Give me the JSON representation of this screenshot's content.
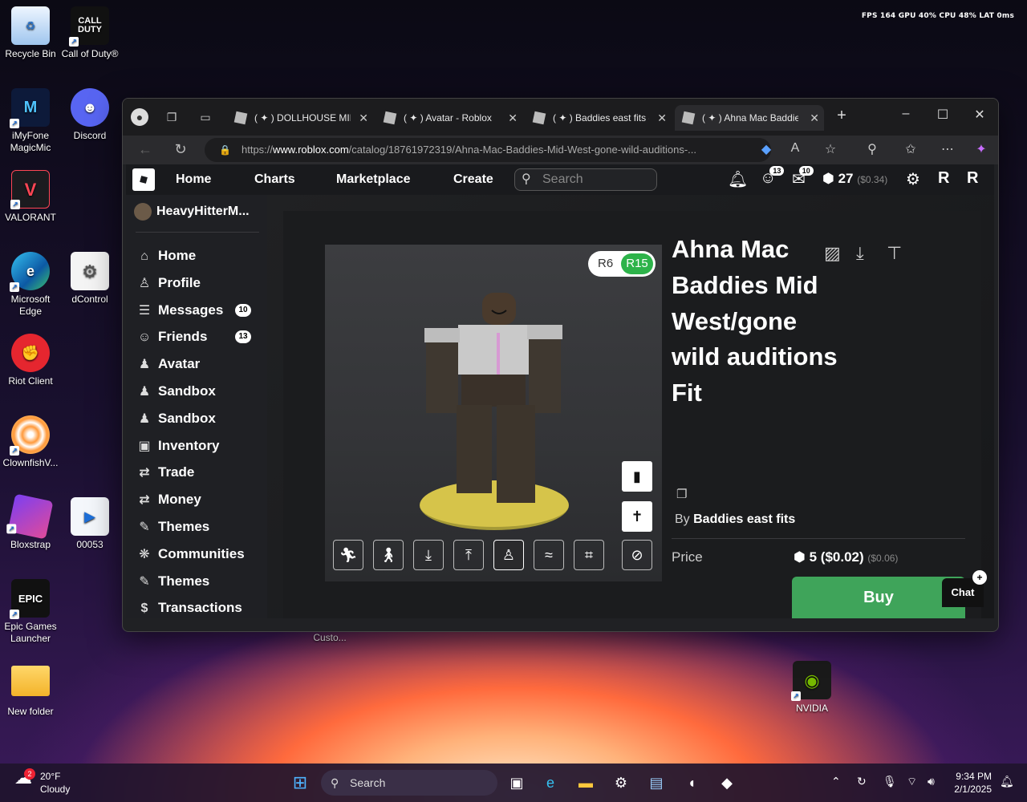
{
  "hud": "FPS 164 GPU 40% CPU 48% LAT 0ms",
  "desktop": {
    "icons": [
      {
        "label": "Recycle Bin"
      },
      {
        "label": "Call of Duty®"
      },
      {
        "label": "iMyFone MagicMic"
      },
      {
        "label": "Discord"
      },
      {
        "label": "VALORANT"
      },
      {
        "label": "Microsoft Edge"
      },
      {
        "label": "dControl"
      },
      {
        "label": "Riot Client"
      },
      {
        "label": "ClownfishV..."
      },
      {
        "label": "Bloxstrap"
      },
      {
        "label": "00053"
      },
      {
        "label": "Epic Games Launcher"
      },
      {
        "label": "New folder"
      },
      {
        "label": "Custo..."
      },
      {
        "label": "NVIDIA"
      }
    ]
  },
  "browser": {
    "tabs": [
      {
        "label": "( ✦ ) DOLLHOUSE MIDWEST"
      },
      {
        "label": "( ✦ ) Avatar - Roblox"
      },
      {
        "label": "( ✦ ) Baddies east fits - Roblox"
      },
      {
        "label": "( ✦ ) Ahna Mac Baddies Mid West"
      }
    ],
    "url_prefix": "https://",
    "url_domain": "www.roblox.com",
    "url_path": "/catalog/18761972319/Ahna-Mac-Baddies-Mid-West-gone-wild-auditions-..."
  },
  "roblox": {
    "nav": {
      "home": "Home",
      "charts": "Charts",
      "marketplace": "Marketplace",
      "create": "Create"
    },
    "search_placeholder": "Search",
    "friends_badge": "13",
    "messages_badge": "10",
    "robux": "27",
    "robux_usd": "($0.34)",
    "sidebar": {
      "username": "HeavyHitterM...",
      "items": [
        {
          "label": "Home",
          "icon": "⌂"
        },
        {
          "label": "Profile",
          "icon": "♙"
        },
        {
          "label": "Messages",
          "icon": "☰",
          "count": "10"
        },
        {
          "label": "Friends",
          "icon": "☺",
          "count": "13"
        },
        {
          "label": "Avatar",
          "icon": "♟"
        },
        {
          "label": "Sandbox",
          "icon": "♟"
        },
        {
          "label": "Sandbox",
          "icon": "♟"
        },
        {
          "label": "Inventory",
          "icon": "▣"
        },
        {
          "label": "Trade",
          "icon": "⇄"
        },
        {
          "label": "Money",
          "icon": "⇄"
        },
        {
          "label": "Themes",
          "icon": "✎"
        },
        {
          "label": "Communities",
          "icon": "❋"
        },
        {
          "label": "Themes",
          "icon": "✎"
        },
        {
          "label": "Transactions",
          "icon": "$"
        }
      ]
    },
    "item": {
      "title": "Ahna Mac Baddies Mid West/gone wild auditions Fit",
      "by_label": "By",
      "creator": "Baddies east fits",
      "price_label": "Price",
      "price": "5",
      "price_usd": "($0.02)",
      "price_usd2": "($0.06)",
      "buy_label": "Buy",
      "rig_r6": "R6",
      "rig_r15": "R15"
    },
    "chat_label": "Chat"
  },
  "taskbar": {
    "temp": "20°F",
    "condition": "Cloudy",
    "weather_badge": "2",
    "search_label": "Search",
    "time": "9:34 PM",
    "date": "2/1/2025"
  }
}
